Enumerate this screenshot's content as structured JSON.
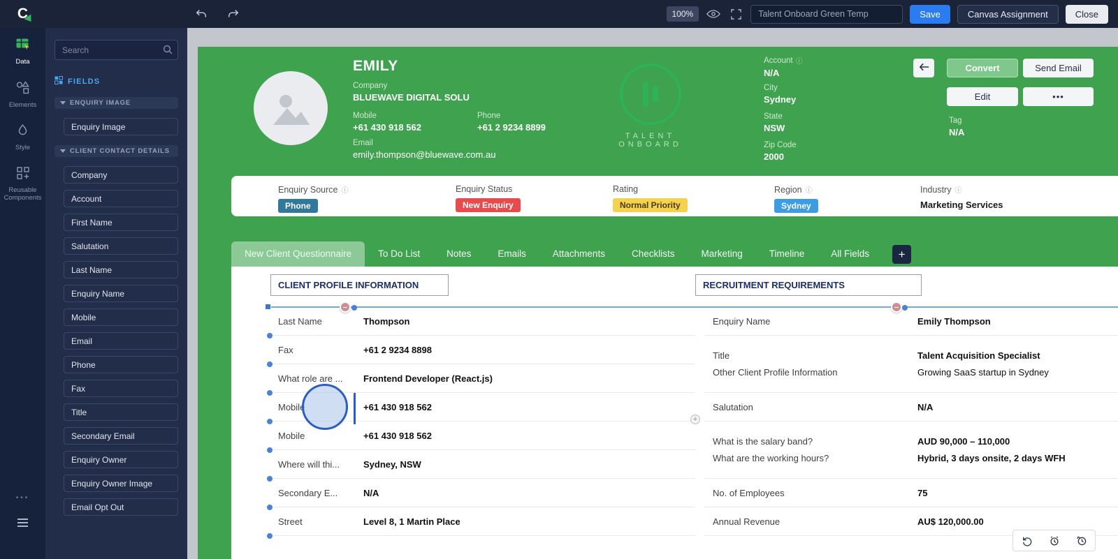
{
  "icons": {
    "info": "ⓘ",
    "more_dots": "•••",
    "plus": "+"
  },
  "topbar": {
    "zoom": "100%",
    "template_name": "Talent Onboard Green Temp",
    "save": "Save",
    "canvas_assignment": "Canvas Assignment",
    "close": "Close"
  },
  "sidebar": {
    "data": "Data",
    "elements": "Elements",
    "style": "Style",
    "reusable": "Reusable Components"
  },
  "fields_panel": {
    "search_placeholder": "Search",
    "title": "FIELDS",
    "section1": {
      "label": "ENQUIRY IMAGE",
      "items": [
        "Enquiry Image"
      ]
    },
    "section2": {
      "label": "CLIENT CONTACT DETAILS",
      "items": [
        "Company",
        "Account",
        "First Name",
        "Salutation",
        "Last Name",
        "Enquiry Name",
        "Mobile",
        "Email",
        "Phone",
        "Fax",
        "Title",
        "Secondary Email",
        "Enquiry Owner",
        "Enquiry Owner Image",
        "Email Opt Out"
      ]
    }
  },
  "record": {
    "name": "EMILY",
    "logo_text": "TALENT ONBOARD",
    "fields": {
      "company": {
        "label": "Company",
        "value": "BLUEWAVE DIGITAL SOLU"
      },
      "mobile": {
        "label": "Mobile",
        "value": "+61 430 918 562"
      },
      "phone": {
        "label": "Phone",
        "value": "+61 2 9234 8899"
      },
      "email": {
        "label": "Email",
        "value": "emily.thompson@bluewave.com.au"
      },
      "account": {
        "label": "Account",
        "value": "N/A"
      },
      "city": {
        "label": "City",
        "value": "Sydney"
      },
      "state": {
        "label": "State",
        "value": "NSW"
      },
      "zip": {
        "label": "Zip Code",
        "value": "2000"
      },
      "tag": {
        "label": "Tag",
        "value": "N/A"
      }
    },
    "buttons": {
      "convert": "Convert",
      "send_email": "Send Email",
      "edit": "Edit"
    }
  },
  "status_bar": {
    "items": [
      {
        "label": "Enquiry Source",
        "value": "Phone",
        "bg": "#31799c",
        "fg": "#ffffff"
      },
      {
        "label": "Enquiry Status",
        "value": "New Enquiry",
        "bg": "#e84b4b",
        "fg": "#ffffff"
      },
      {
        "label": "Rating",
        "value": "Normal Priority",
        "bg": "#f6d14e",
        "fg": "#473c10"
      },
      {
        "label": "Region",
        "value": "Sydney",
        "bg": "#3d9ce4",
        "fg": "#ffffff"
      },
      {
        "label": "Industry",
        "value": "Marketing Services"
      }
    ]
  },
  "tabs": {
    "items": [
      "New Client Questionnaire",
      "To Do List",
      "Notes",
      "Emails",
      "Attachments",
      "Checklists",
      "Marketing",
      "Timeline",
      "All Fields"
    ],
    "active": "New Client Questionnaire"
  },
  "left_section": {
    "title": "CLIENT PROFILE INFORMATION",
    "rows": [
      {
        "label": "Last Name",
        "value": "Thompson"
      },
      {
        "label": "Fax",
        "value": "+61 2 9234 8898"
      },
      {
        "label": "What role are ...",
        "value": "Frontend Developer (React.js)"
      },
      {
        "label": "Mobile",
        "value": "+61 430 918 562"
      },
      {
        "label": "Mobile",
        "value": "+61 430 918 562"
      },
      {
        "label": "Where will thi...",
        "value": "Sydney, NSW"
      },
      {
        "label": "Secondary E...",
        "value": "N/A"
      },
      {
        "label": "Street",
        "value": "Level 8, 1 Martin Place"
      }
    ]
  },
  "right_section": {
    "title": "RECRUITMENT REQUIREMENTS",
    "rows": [
      {
        "label": "Enquiry Name",
        "value": "Emily Thompson"
      },
      {
        "label": "Title",
        "value": "Talent Acquisition Specialist"
      },
      {
        "label": "Other Client Profile Information",
        "value": "Growing SaaS startup in Sydney"
      },
      {
        "label": "Salutation",
        "value": "N/A"
      },
      {
        "label": "What is the salary band?",
        "value": "AUD 90,000 – 110,000"
      },
      {
        "label": "What are the working hours?",
        "value": "Hybrid, 3 days onsite, 2 days WFH"
      },
      {
        "label": "No. of Employees",
        "value": "75"
      },
      {
        "label": "Annual Revenue",
        "value": "AU$ 120,000.00"
      }
    ]
  }
}
